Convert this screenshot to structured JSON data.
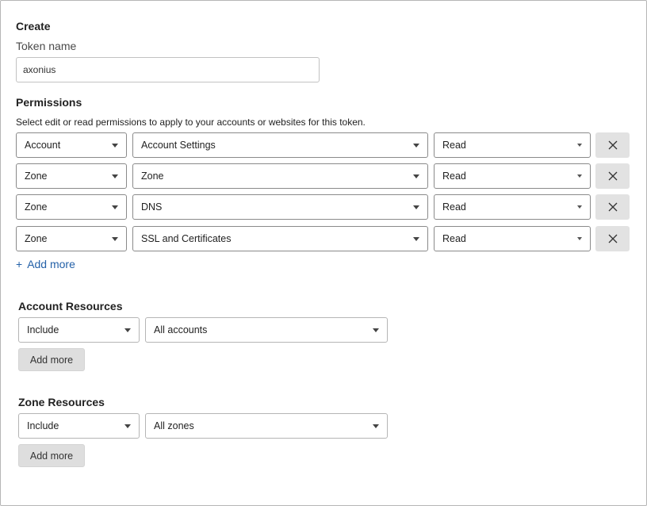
{
  "create": {
    "title": "Create",
    "token_name_label": "Token name",
    "token_name_value": "axonius"
  },
  "permissions": {
    "title": "Permissions",
    "description": "Select edit or read permissions to apply to your accounts or websites for this token.",
    "rows": [
      {
        "scope": "Account",
        "resource": "Account Settings",
        "access": "Read"
      },
      {
        "scope": "Zone",
        "resource": "Zone",
        "access": "Read"
      },
      {
        "scope": "Zone",
        "resource": "DNS",
        "access": "Read"
      },
      {
        "scope": "Zone",
        "resource": "SSL and Certificates",
        "access": "Read"
      }
    ],
    "add_more_label": "Add more"
  },
  "account_resources": {
    "title": "Account Resources",
    "mode": "Include",
    "target": "All accounts",
    "add_more_label": "Add more"
  },
  "zone_resources": {
    "title": "Zone Resources",
    "mode": "Include",
    "target": "All zones",
    "add_more_label": "Add more"
  }
}
